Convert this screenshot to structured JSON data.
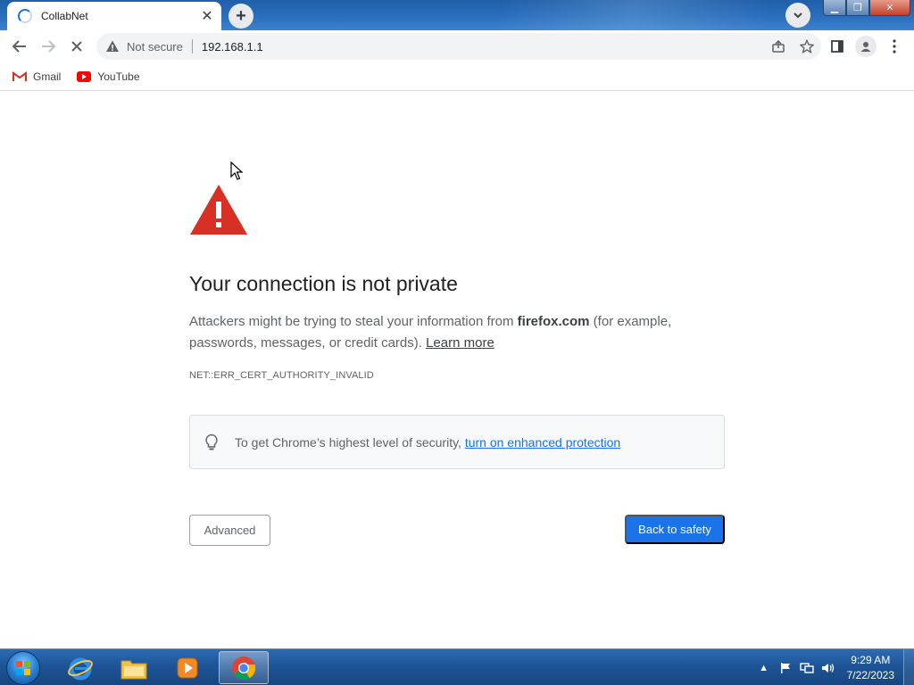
{
  "browser": {
    "tab": {
      "title": "CollabNet"
    },
    "omnibox": {
      "security_label": "Not secure",
      "url": "192.168.1.1"
    },
    "bookmarks": [
      {
        "label": "Gmail",
        "icon": "gmail-icon"
      },
      {
        "label": "YouTube",
        "icon": "youtube-icon"
      }
    ]
  },
  "interstitial": {
    "heading": "Your connection is not private",
    "desc_prefix": "Attackers might be trying to steal your information from ",
    "domain": "firefox.com",
    "desc_suffix": " (for example, passwords, messages, or credit cards). ",
    "learn_more": "Learn more",
    "error_code": "NET::ERR_CERT_AUTHORITY_INVALID",
    "enhanced_prefix": "To get Chrome’s highest level of security, ",
    "enhanced_link": "turn on enhanced protection",
    "advanced_label": "Advanced",
    "back_label": "Back to safety"
  },
  "taskbar": {
    "time": "9:29 AM",
    "date": "7/22/2023"
  },
  "colors": {
    "accent": "#1a73e8",
    "warning_red": "#d93025",
    "titlebar": "#2a6fbd"
  }
}
